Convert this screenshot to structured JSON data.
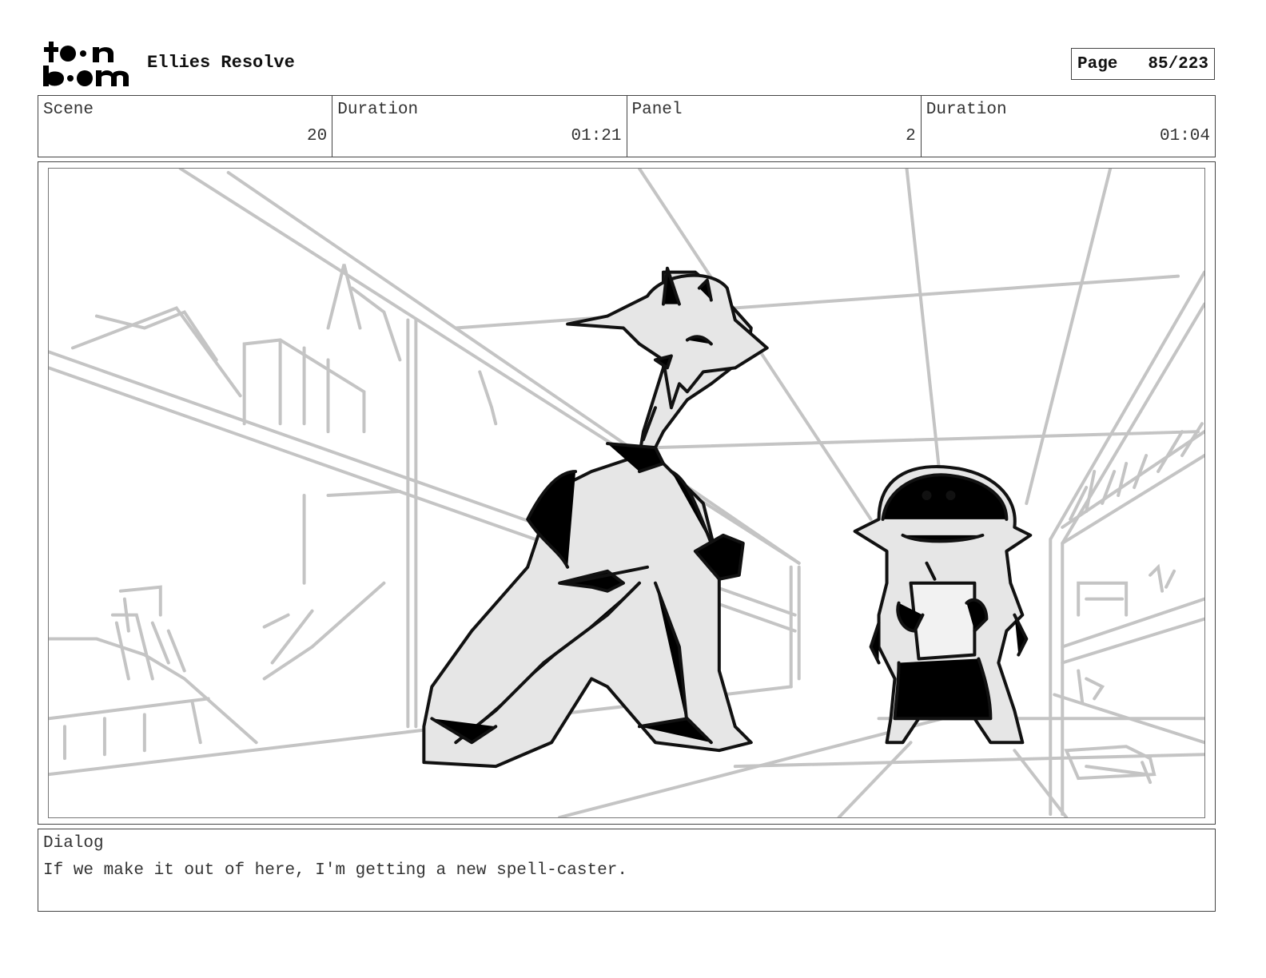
{
  "header": {
    "logo": "toon boom",
    "project_title": "Ellies Resolve",
    "page_label": "Page",
    "page_value": "85/223"
  },
  "info": {
    "scene_label": "Scene",
    "scene_value": "20",
    "scene_duration_label": "Duration",
    "scene_duration_value": "01:21",
    "panel_label": "Panel",
    "panel_value": "2",
    "panel_duration_label": "Duration",
    "panel_duration_value": "01:04"
  },
  "dialog": {
    "label": "Dialog",
    "text": "If we make it out of here, I'm getting a new spell-caster."
  }
}
